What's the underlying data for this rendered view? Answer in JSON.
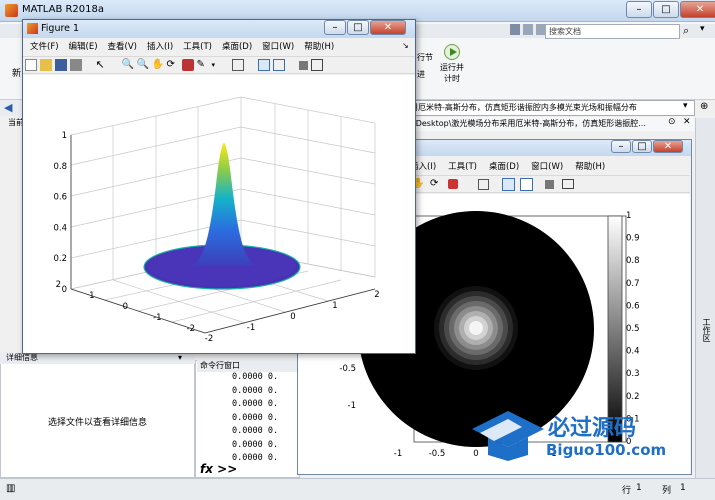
{
  "matlab": {
    "title": "MATLAB R2018a",
    "search_placeholder": "搜索文档",
    "run_section_label_a": "行节",
    "run_section_label_b": "进",
    "run_time_label_a": "运行并",
    "run_time_label_b": "计时",
    "path_text": "用厄米特-高斯分布，仿真矩形谐振腔内多模光束光场和振幅分布",
    "path_text2": "\\Desktop\\激光模场分布采用厄米特-高斯分布，仿真矩形谐振腔...",
    "side_panel_label": "工作区",
    "current_folder_label": "当前",
    "detail_header": "详细信息",
    "detail_message": "选择文件以查看详细信息",
    "cmd_header": "命令行窗口",
    "cmd_rows": [
      "0.0000",
      "0.0000",
      "0.0000",
      "0.0000",
      "0.0000",
      "0.0000",
      "0.0000"
    ],
    "cmd_rows_col2": [
      "0.",
      "0.",
      "0.",
      "0.",
      "0.",
      "0.",
      "0."
    ],
    "prompt": "fx >>",
    "status_row_label": "行",
    "status_row_value": "1",
    "status_col_label": "列",
    "status_col_value": "1"
  },
  "figure1": {
    "title": "Figure 1",
    "menu": [
      "文件(F)",
      "编辑(E)",
      "查看(V)",
      "插入(I)",
      "工具(T)",
      "桌面(D)",
      "窗口(W)",
      "帮助(H)"
    ],
    "z_ticks": [
      "0",
      "0.2",
      "0.4",
      "0.6",
      "0.8",
      "1"
    ],
    "y_ticks": [
      "-2",
      "-1",
      "0",
      "1",
      "2"
    ],
    "x_ticks": [
      "-2",
      "-1",
      "0",
      "1",
      "2"
    ]
  },
  "figure2": {
    "menu": [
      "插入(I)",
      "工具(T)",
      "桌面(D)",
      "窗口(W)",
      "帮助(H)"
    ],
    "colorbar_ticks": [
      "0",
      "0.1",
      "0.2",
      "0.3",
      "0.4",
      "0.5",
      "0.6",
      "0.7",
      "0.8",
      "0.9",
      "1"
    ],
    "y_ticks": [
      "-0.5",
      "-1"
    ],
    "x_ticks": [
      "-1",
      "-0.5",
      "0",
      "0.5",
      "1"
    ]
  },
  "watermark": {
    "text_cn": "必过源码",
    "text_en": "Biguo100.com"
  },
  "colors": {
    "peak_top": "#f9e81e",
    "peak_mid": "#21a2d4",
    "base": "#4732b2",
    "watermark_blue": "#1e6fc8"
  }
}
